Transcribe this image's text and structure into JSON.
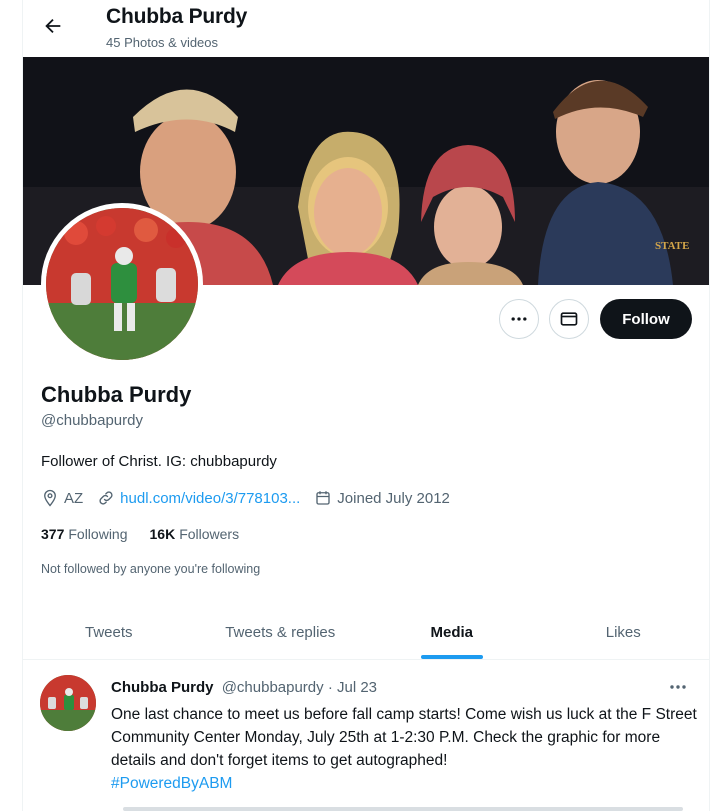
{
  "header": {
    "name": "Chubba Purdy",
    "media_count": "45 Photos & videos"
  },
  "profile": {
    "name": "Chubba Purdy",
    "handle": "@chubbapurdy",
    "bio": "Follower of Christ. IG: chubbapurdy",
    "location": "AZ",
    "website": "hudl.com/video/3/778103...",
    "joined": "Joined July 2012",
    "following_count": "377",
    "following_label": "Following",
    "followers_count": "16K",
    "followers_label": "Followers",
    "not_followed": "Not followed by anyone you're following",
    "banner_emblem": "STATE"
  },
  "actions": {
    "follow_label": "Follow"
  },
  "tabs": [
    {
      "label": "Tweets",
      "active": false
    },
    {
      "label": "Tweets & replies",
      "active": false
    },
    {
      "label": "Media",
      "active": true
    },
    {
      "label": "Likes",
      "active": false
    }
  ],
  "tweet": {
    "author": "Chubba Purdy",
    "handle": "@chubbapurdy",
    "separator": "·",
    "date": "Jul 23",
    "text": "One last chance to meet us before fall camp starts! Come wish us luck at the F Street Community Center Monday, July 25th at 1-2:30 P.M. Check the graphic for more details and don't forget items to get autographed!",
    "hashtag": "#PoweredByABM"
  },
  "colors": {
    "accent": "#1d9bf0",
    "text_primary": "#0f1419",
    "text_secondary": "#536471",
    "follow_button_bg": "#0f1419"
  },
  "icons": [
    "back-arrow-icon",
    "more-icon",
    "message-icon",
    "location-icon",
    "link-icon",
    "calendar-icon"
  ]
}
